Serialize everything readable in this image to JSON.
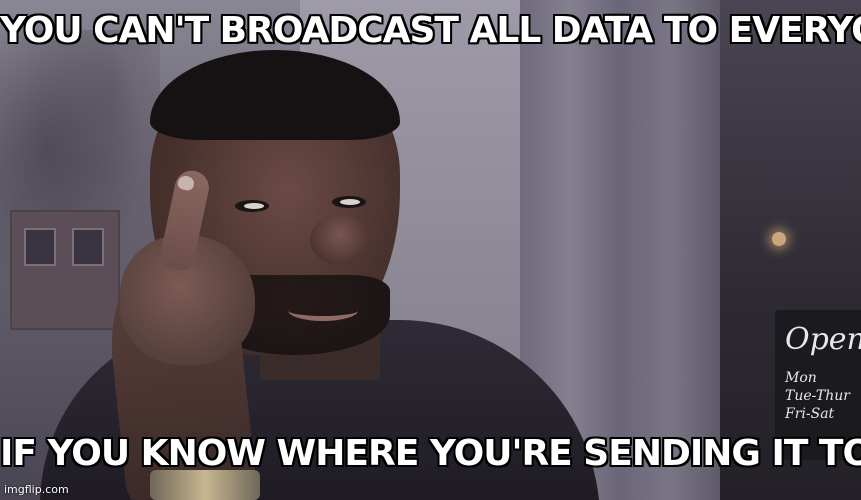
{
  "meme": {
    "top_text": "YOU CAN'T BROADCAST ALL DATA TO EVERYONE",
    "bottom_text": "IF YOU KNOW WHERE YOU'RE SENDING IT TO",
    "watermark": "imgflip.com"
  },
  "sign": {
    "line1": "Open",
    "line2": "Mon",
    "line3": "Tue-Thur",
    "line4": "Fri-Sat"
  },
  "colors": {
    "caption_text": "#ffffff",
    "caption_outline": "#000000"
  }
}
